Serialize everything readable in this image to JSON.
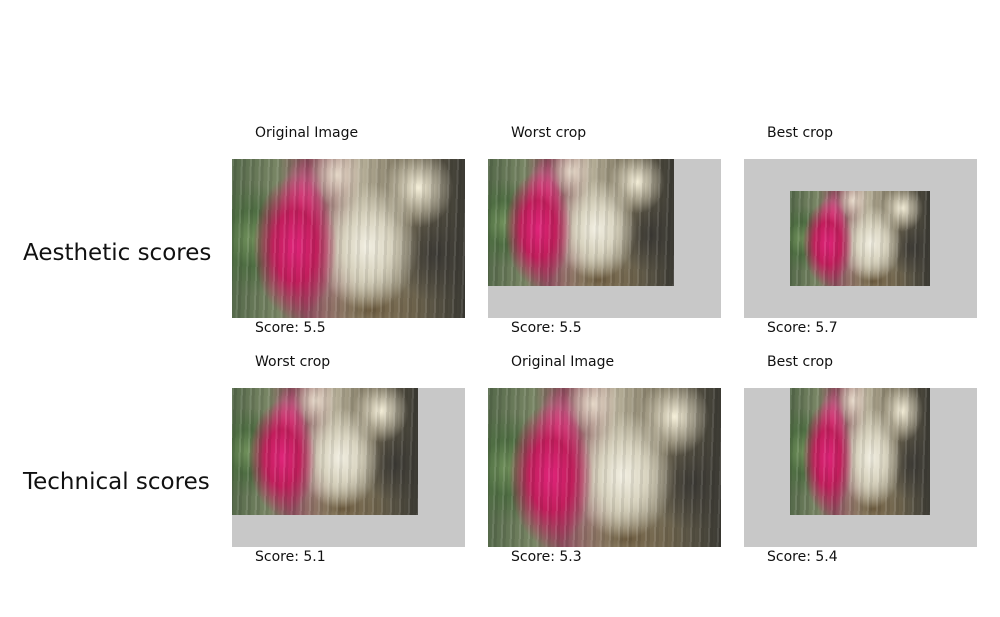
{
  "rows": [
    {
      "label": "Aesthetic scores",
      "panels": [
        {
          "caption": "Original Image",
          "score": "Score: 5.5"
        },
        {
          "caption": "Worst crop",
          "score": "Score: 5.5"
        },
        {
          "caption": "Best crop",
          "score": "Score: 5.7"
        }
      ]
    },
    {
      "label": "Technical scores",
      "panels": [
        {
          "caption": "Worst crop",
          "score": "Score: 5.1"
        },
        {
          "caption": "Original Image",
          "score": "Score: 5.3"
        },
        {
          "caption": "Best crop",
          "score": "Score: 5.4"
        }
      ]
    }
  ],
  "colors": {
    "crop_background": "#c8c8c8",
    "text": "#111111"
  }
}
